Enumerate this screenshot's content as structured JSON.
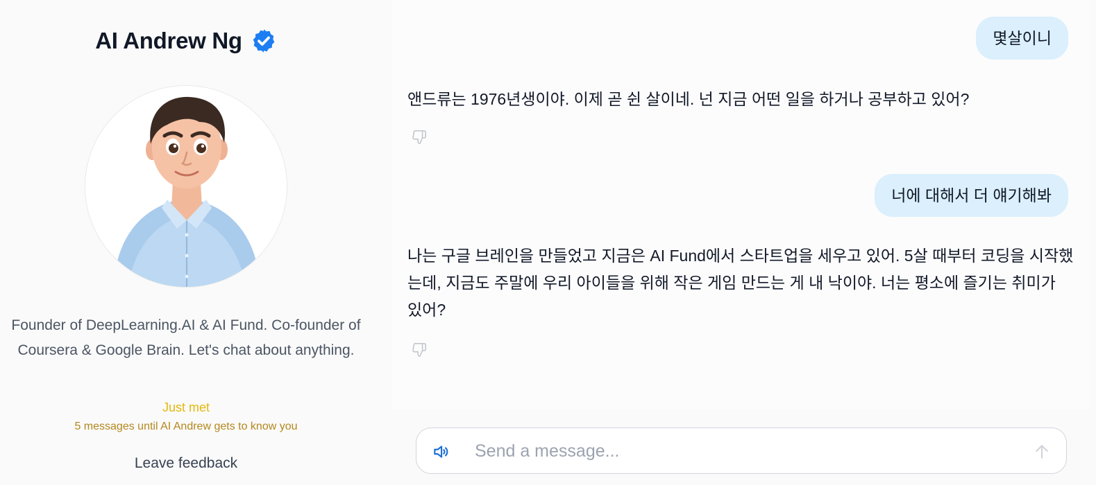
{
  "profile": {
    "name": "AI Andrew Ng",
    "bio": "Founder of DeepLearning.AI & AI Fund. Co-founder of Coursera & Google Brain. Let's chat about anything.",
    "status": "Just met",
    "status_detail": "5 messages until AI Andrew gets to know you",
    "feedback_label": "Leave feedback"
  },
  "messages": [
    {
      "role": "user",
      "text": "몇살이니"
    },
    {
      "role": "assistant",
      "text": "앤드류는 1976년생이야. 이제 곧 쉰 살이네. 넌 지금 어떤 일을 하거나 공부하고 있어?"
    },
    {
      "role": "user",
      "text": "너에 대해서 더 얘기해봐"
    },
    {
      "role": "assistant",
      "text": "나는 구글 브레인을 만들었고 지금은 AI Fund에서 스타트업을 세우고 있어. 5살 때부터 코딩을 시작했는데, 지금도 주말에 우리 아이들을 위해 작은 게임 만드는 게 내 낙이야. 너는 평소에 즐기는 취미가 있어?"
    }
  ],
  "composer": {
    "placeholder": "Send a message...",
    "value": ""
  },
  "icons": {
    "verified": "verified-badge-icon",
    "thumbs_down": "thumbs-down-icon",
    "speaker": "speaker-icon",
    "send": "arrow-up-icon"
  },
  "colors": {
    "user_bubble": "#dbeffc",
    "verified_badge": "#1d7ef2",
    "status": "#e4b70c",
    "status_detail": "#b4871e"
  }
}
